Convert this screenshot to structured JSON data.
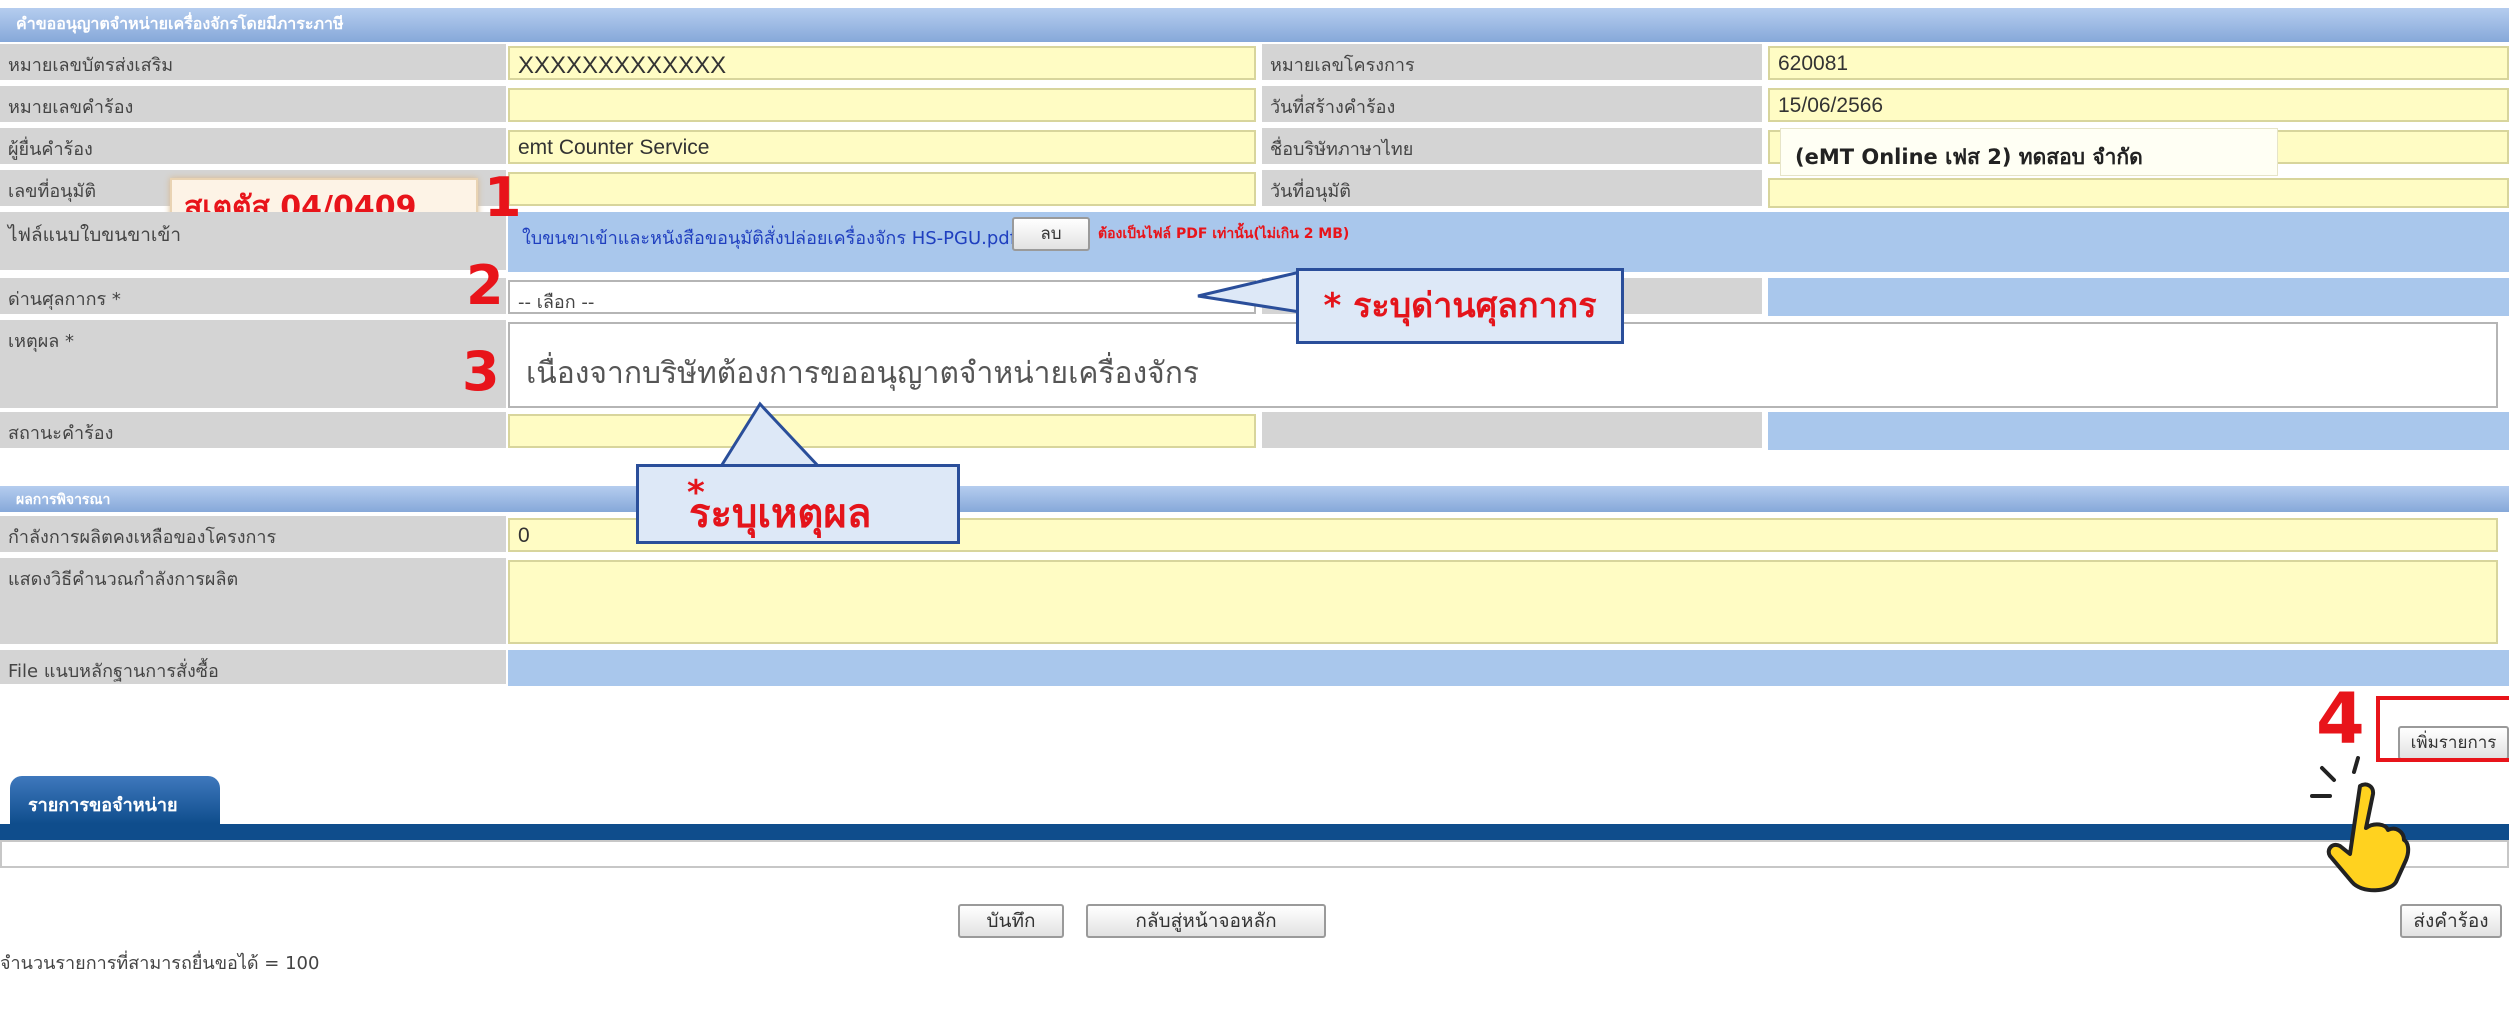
{
  "section": {
    "title": "คำขออนุญาตจำหน่ายเครื่องจักรโดยมีภาระภาษี",
    "result_title": "ผลการพิจารณา"
  },
  "form": {
    "promo_card_label": "หมายเลขบัตรส่งเสริม",
    "promo_card_value": "XXXXXXXXXXXXX",
    "project_no_label": "หมายเลขโครงการ",
    "project_no_value": "620081",
    "request_no_label": "หมายเลขคำร้อง",
    "request_no_value": "",
    "request_date_label": "วันที่สร้างคำร้อง",
    "request_date_value": "15/06/2566",
    "submitter_label": "ผู้ยื่นคำร้อง",
    "submitter_value": "emt Counter Service",
    "company_label": "ชื่อบริษัทภาษาไทย",
    "company_value": "(eMT Online เฟส 2) ทดสอบ จำกัด",
    "approval_no_label": "เลขที่อนุมัติ",
    "approval_no_value": "",
    "approval_date_label": "วันที่อนุมัติ",
    "approval_date_value": "",
    "attach_label": "ไฟล์แนบใบขนขาเข้า",
    "attach_file": "ใบขนขาเข้าและหนังสือขอนุมัติสั่งปล่อยเครื่องจักร HS-PGU.pdf",
    "attach_delete": "ลบ",
    "attach_note": "ต้องเป็นไฟล์ PDF เท่านั้น(ไม่เกิน 2 MB)",
    "customs_label": "ด่านศุลกากร *",
    "customs_select": "-- เลือก --",
    "reason_label": "เหตุผล *",
    "reason_value": "เนื่องจากบริษัทต้องการขออนุญาตจำหน่ายเครื่องจักร",
    "status_label": "สถานะคำร้อง",
    "status_value": "",
    "capacity_label": "กำลังการผลิตคงเหลือของโครงการ",
    "capacity_value": "0",
    "calc_label": "แสดงวิธีคำนวณกำลังการผลิต",
    "calc_value": "",
    "evidence_label": "File แนบหลักฐานการสั่งซื้อ"
  },
  "annotations": {
    "status_stamp": "สเตตัส 04/0409",
    "num1": "1",
    "num2": "2",
    "num3": "3",
    "num4": "4",
    "customs_callout": "* ระบุด่านศุลกากร",
    "reason_callout_star": "*",
    "reason_callout": "ระบุเหตุผล"
  },
  "buttons": {
    "add_item": "เพิ่มรายการ",
    "save": "บันทึก",
    "back": "กลับสู่หน้าจอหลัก",
    "submit": "ส่งคำร้อง"
  },
  "tab": {
    "label": "รายการขอจำหน่าย"
  },
  "footer": {
    "note": "จำนวนรายการที่สามารถยื่นขอได้ = 100"
  },
  "colors": {
    "label_bg": "#d4d4d4",
    "field_bg": "#fffcc4",
    "band_bg": "#a9c7ec",
    "accent_red": "#e8141a",
    "tab_blue": "#0f4d8c"
  }
}
